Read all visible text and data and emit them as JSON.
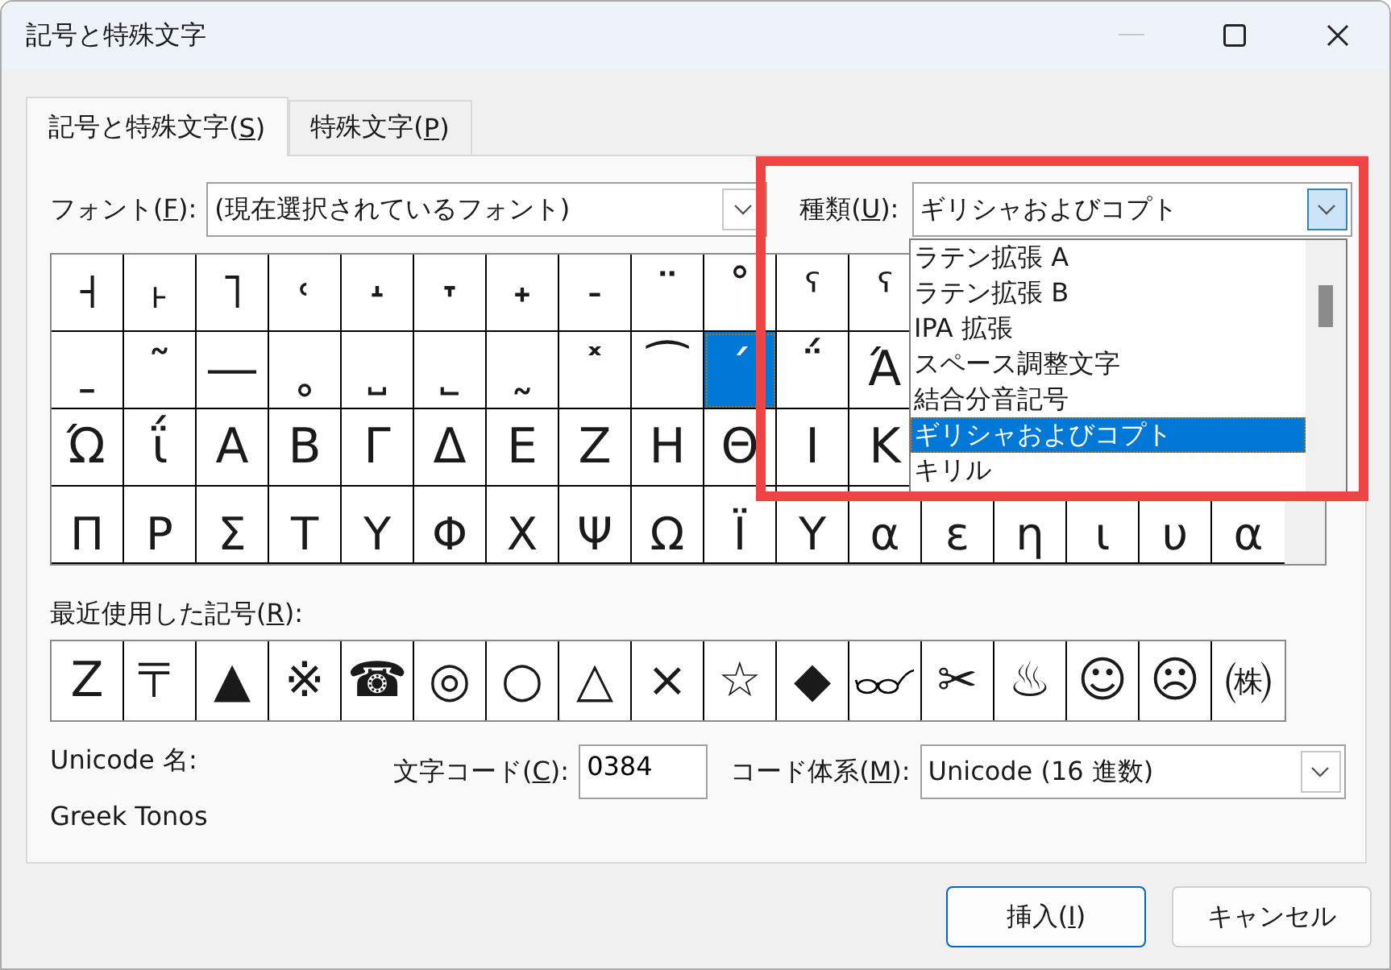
{
  "window": {
    "title": "記号と特殊文字",
    "minimize_disabled": true
  },
  "tabs": [
    {
      "label_parts": [
        "記号と特殊文字(",
        "S",
        ")"
      ],
      "selected": true
    },
    {
      "label_parts": [
        "特殊文字(",
        "P",
        ")"
      ],
      "selected": false
    }
  ],
  "font_field": {
    "label_parts": [
      "フォント(",
      "F",
      "):"
    ],
    "value": "(現在選択されているフォント)"
  },
  "subset_field": {
    "label_parts": [
      "種類(",
      "U",
      "):"
    ],
    "value": "ギリシャおよびコプト",
    "open": true
  },
  "subset_list": [
    {
      "label": "ラテン拡張 A",
      "selected": false
    },
    {
      "label": "ラテン拡張 B",
      "selected": false
    },
    {
      "label": "IPA 拡張",
      "selected": false
    },
    {
      "label": "スペース調整文字",
      "selected": false
    },
    {
      "label": "結合分音記号",
      "selected": false
    },
    {
      "label": "ギリシャおよびコプト",
      "selected": true
    },
    {
      "label": "キリル",
      "selected": false
    }
  ],
  "symbol_grid": [
    {
      "cells": [
        {
          "char": "˧",
          "selected": false
        },
        {
          "char": "˫",
          "selected": false
        },
        {
          "char": "˥",
          "selected": false
        },
        {
          "char": "˓",
          "selected": false
        },
        {
          "char": "˔",
          "selected": false
        },
        {
          "char": "˕",
          "selected": false
        },
        {
          "char": "˖",
          "selected": false
        },
        {
          "char": "˗",
          "selected": false
        },
        {
          "char": "¨",
          "selected": false
        },
        {
          "char": "˚",
          "selected": false
        },
        {
          "char": "ˤ",
          "selected": false
        },
        {
          "char": "ˁ",
          "selected": false
        }
      ]
    },
    {
      "cells": [
        {
          "char": "ˍ",
          "selected": false
        },
        {
          "char": "˜",
          "selected": false
        },
        {
          "char": "―",
          "selected": false
        },
        {
          "char": "˳",
          "selected": false
        },
        {
          "char": "˽",
          "selected": false
        },
        {
          "char": "˾",
          "selected": false
        },
        {
          "char": "˷",
          "selected": false
        },
        {
          "char": "˟",
          "selected": false
        },
        {
          "char": "⁀",
          "selected": false
        },
        {
          "char": "΄",
          "selected": true
        },
        {
          "char": "΅",
          "selected": false
        },
        {
          "char": "Ά",
          "selected": false
        }
      ]
    },
    {
      "cells": [
        {
          "char": "Ώ",
          "selected": false
        },
        {
          "char": "ΐ",
          "selected": false
        },
        {
          "char": "Α",
          "selected": false
        },
        {
          "char": "Β",
          "selected": false
        },
        {
          "char": "Γ",
          "selected": false
        },
        {
          "char": "Δ",
          "selected": false
        },
        {
          "char": "Ε",
          "selected": false
        },
        {
          "char": "Ζ",
          "selected": false
        },
        {
          "char": "Η",
          "selected": false
        },
        {
          "char": "Θ",
          "selected": false
        },
        {
          "char": "Ι",
          "selected": false
        },
        {
          "char": "Κ",
          "selected": false
        }
      ]
    },
    {
      "cells": [
        {
          "char": "Π",
          "selected": false
        },
        {
          "char": "Ρ",
          "selected": false
        },
        {
          "char": "Σ",
          "selected": false
        },
        {
          "char": "Τ",
          "selected": false
        },
        {
          "char": "Υ",
          "selected": false
        },
        {
          "char": "Φ",
          "selected": false
        },
        {
          "char": "Χ",
          "selected": false
        },
        {
          "char": "Ψ",
          "selected": false
        },
        {
          "char": "Ω",
          "selected": false
        },
        {
          "char": "Ϊ",
          "selected": false
        },
        {
          "char": "Υ",
          "selected": false
        },
        {
          "char": "α",
          "selected": false
        },
        {
          "char": "ε",
          "selected": false
        },
        {
          "char": "η",
          "selected": false
        },
        {
          "char": "ι",
          "selected": false
        },
        {
          "char": "υ",
          "selected": false
        },
        {
          "char": "α",
          "selected": false
        }
      ]
    }
  ],
  "recent_label_parts": [
    "最近使用した記号(",
    "R",
    "):"
  ],
  "recent_symbols": [
    {
      "kind": "char",
      "char": "Z"
    },
    {
      "kind": "char",
      "char": "〒"
    },
    {
      "kind": "char",
      "char": "▲"
    },
    {
      "kind": "char",
      "char": "※"
    },
    {
      "kind": "char",
      "char": "☎"
    },
    {
      "kind": "char",
      "char": "◎"
    },
    {
      "kind": "char",
      "char": "○"
    },
    {
      "kind": "char",
      "char": "△"
    },
    {
      "kind": "char",
      "char": "×"
    },
    {
      "kind": "char",
      "char": "☆"
    },
    {
      "kind": "char",
      "char": "◆"
    },
    {
      "kind": "drawing"
    },
    {
      "kind": "char",
      "char": "✂"
    },
    {
      "kind": "char",
      "char": "♨"
    },
    {
      "kind": "char",
      "char": "☺"
    },
    {
      "kind": "char",
      "char": "☹"
    },
    {
      "kind": "char",
      "char": "㈱"
    }
  ],
  "unicode_name_label": "Unicode 名:",
  "unicode_name": "Greek Tonos",
  "char_code": {
    "label_parts": [
      "文字コード(",
      "C",
      "):"
    ],
    "value": "0384"
  },
  "code_system": {
    "label_parts": [
      "コード体系(",
      "M",
      "):"
    ],
    "value": "Unicode (16 進数)"
  },
  "buttons": [
    {
      "label_parts": [
        "挿入(",
        "I",
        ")"
      ],
      "default": true
    },
    {
      "label_parts": [
        "キャンセル"
      ],
      "default": false
    }
  ],
  "highlight_frame": true
}
